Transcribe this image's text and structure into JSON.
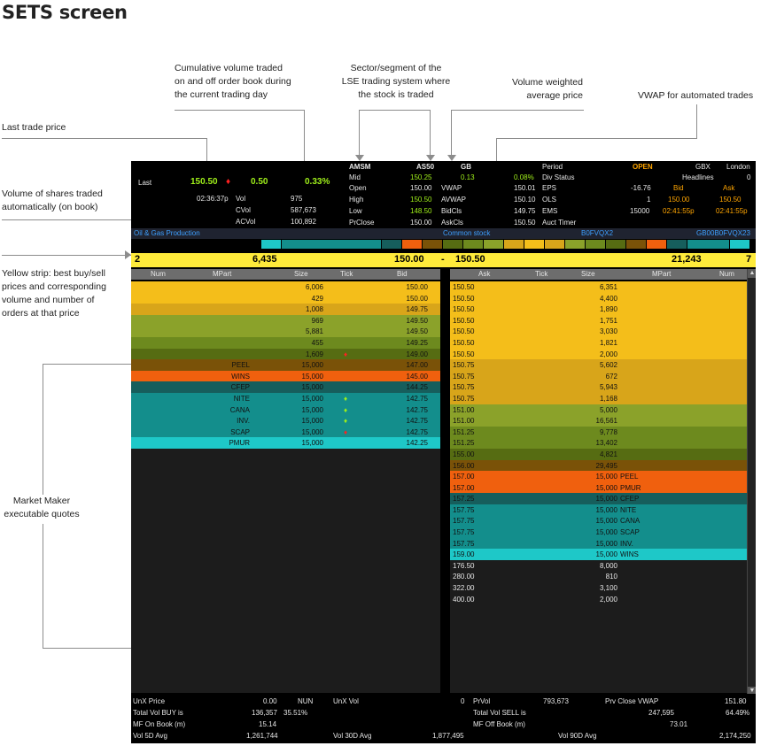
{
  "title": "SETS screen",
  "annotations": {
    "cumvol": [
      "Cumulative volume traded",
      "on and off order book during",
      "the current trading day"
    ],
    "sector": [
      "Sector/segment of the",
      "LSE trading system where",
      "the stock is traded"
    ],
    "vwap": [
      "Volume weighted",
      "average price"
    ],
    "auto_vwap": "VWAP for automated trades",
    "last_trade": "Last trade price",
    "vol_auto": [
      "Volume of shares traded",
      "automatically (on book)"
    ],
    "yellow": [
      "Yellow strip: best buy/sell",
      "prices and corresponding",
      "volume and number of",
      "orders at that price"
    ],
    "mm": [
      "Market Maker",
      "executable quotes"
    ]
  },
  "header": {
    "last_label": "Last",
    "last_price": "150.50",
    "change": "0.50",
    "change_pct": "0.33%",
    "time": "02:36:37p",
    "vol_label": "Vol",
    "vol": "975",
    "cvol_label": "CVol",
    "cvol": "587,673",
    "acvol_label": "ACVol",
    "acvol": "100,892",
    "amsm": "AMSM",
    "as50": "AS50",
    "gb": "GB",
    "mid_label": "Mid",
    "mid": "150.25",
    "mid_chg": "0.13",
    "mid_pct": "0.08%",
    "open_label": "Open",
    "open": "150.00",
    "high_label": "High",
    "high": "150.50",
    "low_label": "Low",
    "low": "148.50",
    "prclose_label": "PrClose",
    "prclose": "150.00",
    "vwap_label": "VWAP",
    "vwap": "150.01",
    "avwap_label": "AVWAP",
    "avwap": "150.10",
    "bidcls_label": "BidCls",
    "bidcls": "149.75",
    "askcls_label": "AskCls",
    "askcls": "150.50",
    "period_label": "Period",
    "divstatus_label": "Div Status",
    "eps_label": "EPS",
    "eps": "-16.76",
    "ols_label": "OLS",
    "ols": "1",
    "ems_label": "EMS",
    "ems": "15000",
    "auct_label": "Auct Timer",
    "status": "OPEN",
    "gbx": "GBX",
    "london": "London",
    "headlines_label": "Headlines",
    "headlines": "0",
    "bid_label": "Bid",
    "ask_label": "Ask",
    "bid_px": "150.00",
    "ask_px": "150.50",
    "bid_time": "02:41:55p",
    "ask_time": "02:41:55p"
  },
  "sector_bar": {
    "sector": "Oil & Gas Production",
    "type": "Common stock",
    "code": "B0FVQX2",
    "isin": "GB00B0FVQX23"
  },
  "strip": {
    "bid_num": "2",
    "bid_size": "6,435",
    "bid": "150.00",
    "dash": "-",
    "ask": "150.50",
    "ask_size": "21,243",
    "ask_num": "7"
  },
  "columns": {
    "num": "Num",
    "mpart": "MPart",
    "size": "Size",
    "tick": "Tick",
    "bid": "Bid",
    "ask": "Ask"
  },
  "bids": [
    {
      "mpart": "",
      "size": "6,006",
      "tick": "",
      "price": "150.00",
      "bg": "#f4be1a"
    },
    {
      "mpart": "",
      "size": "429",
      "tick": "",
      "price": "150.00",
      "bg": "#f4be1a"
    },
    {
      "mpart": "",
      "size": "1,008",
      "tick": "",
      "price": "149.75",
      "bg": "#d8a51a"
    },
    {
      "mpart": "",
      "size": "969",
      "tick": "",
      "price": "149.50",
      "bg": "#8ba22a"
    },
    {
      "mpart": "",
      "size": "5,881",
      "tick": "",
      "price": "149.50",
      "bg": "#8ba22a"
    },
    {
      "mpart": "",
      "size": "455",
      "tick": "",
      "price": "149.25",
      "bg": "#6d8a1e"
    },
    {
      "mpart": "",
      "size": "1,609",
      "tick": "dn",
      "price": "149.00",
      "bg": "#566c12"
    },
    {
      "mpart": "PEEL",
      "size": "15,000",
      "tick": "",
      "price": "147.00",
      "bg": "#7a5208"
    },
    {
      "mpart": "WINS",
      "size": "15,000",
      "tick": "",
      "price": "145.00",
      "bg": "#f0600e"
    },
    {
      "mpart": "CFEP",
      "size": "15,000",
      "tick": "",
      "price": "144.25",
      "bg": "#165e5c"
    },
    {
      "mpart": "NITE",
      "size": "15,000",
      "tick": "up",
      "price": "142.75",
      "bg": "#138e8c"
    },
    {
      "mpart": "CANA",
      "size": "15,000",
      "tick": "up",
      "price": "142.75",
      "bg": "#138e8c"
    },
    {
      "mpart": "INV.",
      "size": "15,000",
      "tick": "up",
      "price": "142.75",
      "bg": "#138e8c"
    },
    {
      "mpart": "SCAP",
      "size": "15,000",
      "tick": "dn",
      "price": "142.75",
      "bg": "#138e8c"
    },
    {
      "mpart": "PMUR",
      "size": "15,000",
      "tick": "",
      "price": "142.25",
      "bg": "#1ec8c8"
    }
  ],
  "asks": [
    {
      "price": "150.50",
      "size": "6,351",
      "mpart": "",
      "bg": "#f4be1a"
    },
    {
      "price": "150.50",
      "size": "4,400",
      "mpart": "",
      "bg": "#f4be1a"
    },
    {
      "price": "150.50",
      "size": "1,890",
      "mpart": "",
      "bg": "#f4be1a"
    },
    {
      "price": "150.50",
      "size": "1,751",
      "mpart": "",
      "bg": "#f4be1a"
    },
    {
      "price": "150.50",
      "size": "3,030",
      "mpart": "",
      "bg": "#f4be1a"
    },
    {
      "price": "150.50",
      "size": "1,821",
      "mpart": "",
      "bg": "#f4be1a"
    },
    {
      "price": "150.50",
      "size": "2,000",
      "mpart": "",
      "bg": "#f4be1a"
    },
    {
      "price": "150.75",
      "size": "5,602",
      "mpart": "",
      "bg": "#d8a51a"
    },
    {
      "price": "150.75",
      "size": "672",
      "mpart": "",
      "bg": "#d8a51a"
    },
    {
      "price": "150.75",
      "size": "5,943",
      "mpart": "",
      "bg": "#d8a51a"
    },
    {
      "price": "150.75",
      "size": "1,168",
      "mpart": "",
      "bg": "#d8a51a"
    },
    {
      "price": "151.00",
      "size": "5,000",
      "mpart": "",
      "bg": "#8ba22a"
    },
    {
      "price": "151.00",
      "size": "16,561",
      "mpart": "",
      "bg": "#8ba22a"
    },
    {
      "price": "151.25",
      "size": "9,778",
      "mpart": "",
      "bg": "#6d8a1e"
    },
    {
      "price": "151.25",
      "size": "13,402",
      "mpart": "",
      "bg": "#6d8a1e"
    },
    {
      "price": "155.00",
      "size": "4,821",
      "mpart": "",
      "bg": "#566c12"
    },
    {
      "price": "156.00",
      "size": "29,495",
      "mpart": "",
      "bg": "#7a5208"
    },
    {
      "price": "157.00",
      "size": "15,000",
      "mpart": "PEEL",
      "bg": "#f0600e"
    },
    {
      "price": "157.00",
      "size": "15,000",
      "mpart": "PMUR",
      "bg": "#f0600e"
    },
    {
      "price": "157.25",
      "size": "15,000",
      "mpart": "CFEP",
      "bg": "#165e5c"
    },
    {
      "price": "157.75",
      "size": "15,000",
      "mpart": "NITE",
      "bg": "#138e8c"
    },
    {
      "price": "157.75",
      "size": "15,000",
      "mpart": "CANA",
      "bg": "#138e8c"
    },
    {
      "price": "157.75",
      "size": "15,000",
      "mpart": "SCAP",
      "bg": "#138e8c"
    },
    {
      "price": "157.75",
      "size": "15,000",
      "mpart": "INV.",
      "bg": "#138e8c"
    },
    {
      "price": "159.00",
      "size": "15,000",
      "mpart": "WINS",
      "bg": "#1ec8c8"
    },
    {
      "price": "176.50",
      "size": "8,000",
      "mpart": "",
      "bg": "#1c1c1c"
    },
    {
      "price": "280.00",
      "size": "810",
      "mpart": "",
      "bg": "#1c1c1c"
    },
    {
      "price": "322.00",
      "size": "3,100",
      "mpart": "",
      "bg": "#1c1c1c"
    },
    {
      "price": "400.00",
      "size": "2,000",
      "mpart": "",
      "bg": "#1c1c1c"
    }
  ],
  "footer": {
    "unx_price_label": "UnX Price",
    "unx_price": "0.00",
    "nun": "NUN",
    "unx_vol_label": "UnX Vol",
    "unx_vol": "0",
    "prvol_label": "PrVol",
    "prvol": "793,673",
    "prv_close_vwap_label": "Prv Close VWAP",
    "prv_close_vwap": "151.80",
    "tot_buy_label": "Total Vol BUY is",
    "tot_buy": "136,357",
    "tot_buy_pct": "35.51%",
    "tot_sell_label": "Total Vol SELL is",
    "tot_sell": "247,595",
    "tot_sell_pct": "64.49%",
    "mf_on_label": "MF On Book (m)",
    "mf_on": "15.14",
    "mf_off_label": "MF Off Book (m)",
    "mf_off": "73.01",
    "vol5_label": "Vol 5D Avg",
    "vol5": "1,261,744",
    "vol30_label": "Vol 30D Avg",
    "vol30": "1,877,495",
    "vol90_label": "Vol 90D Avg",
    "vol90": "2,174,250"
  },
  "colors": {
    "accent_green": "#9fef1a",
    "accent_yellow": "#ffd400",
    "accent_orange": "#ffa500",
    "strip_yellow": "#ffeb3b"
  },
  "scroll": {
    "up_icon": "▲",
    "down_icon": "▼"
  }
}
